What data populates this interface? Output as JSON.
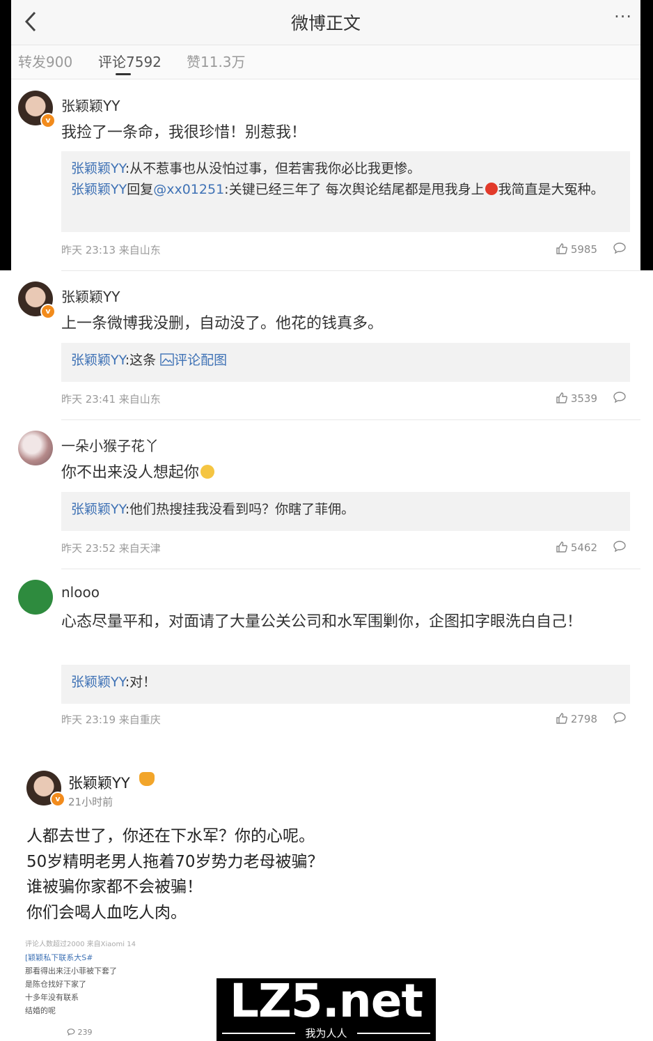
{
  "header": {
    "title": "微博正文",
    "more": "···"
  },
  "tabs": [
    {
      "label": "转发900"
    },
    {
      "label": "评论7592"
    },
    {
      "label": "赞11.3万"
    }
  ],
  "comments": [
    {
      "user": "张颖颖YY",
      "text": "我捡了一条命，我很珍惜！别惹我！",
      "replies": [
        {
          "name": "张颖颖YY",
          "body": ":从不惹事也从没怕过事，但若害我你必比我更惨。"
        },
        {
          "name": "张颖颖YY",
          "mid": "回复",
          "mention": "@xx01251",
          "body": ":关键已经三年了 每次舆论结尾都是甩我身上",
          "body2": "我简直是大冤种。"
        }
      ],
      "meta": "昨天 23:13 来自山东",
      "likes": "5985"
    },
    {
      "user": "张颖颖YY",
      "text": "上一条微博我没删，自动没了。他花的钱真多。",
      "replies": [
        {
          "name": "张颖颖YY",
          "body": ":这条 ",
          "link": "评论配图"
        }
      ],
      "meta": "昨天 23:41 来自山东",
      "likes": "3539"
    },
    {
      "user": "一朵小猴子花丫",
      "text": "你不出来没人想起你",
      "replies": [
        {
          "name": "张颖颖YY",
          "body": ":他们热搜挂我没看到吗？你瞎了菲佣。"
        }
      ],
      "meta": "昨天 23:52 来自天津",
      "likes": "5462"
    },
    {
      "user": "nlooo",
      "text": "心态尽量平和，对面请了大量公关公司和水军围剿你，企图扣字眼洗白自己！",
      "replies": [
        {
          "name": "张颖颖YY",
          "body": ":对！"
        }
      ],
      "meta": "昨天 23:19 来自重庆",
      "likes": "2798"
    }
  ],
  "post": {
    "user": "张颖颖YY",
    "time": "21小时前",
    "lines": [
      "人都去世了，你还在下水军？你的心呢。",
      "50岁精明老男人拖着70岁势力老母被骗？",
      "谁被骗你家都不会被骗！",
      "你们会喝人血吃人肉。"
    ]
  },
  "faded": {
    "meta": "评论人数超过2000  来自Xiaomi 14",
    "link": "[颖颖私下联系大S#",
    "lines": [
      "那看得出来汪小菲被下套了",
      "是陈仓找好下家了",
      "十多年没有联系",
      "结婚的呢"
    ],
    "count": "239"
  },
  "watermark": {
    "big": "LZ5.net",
    "small": "我为人人"
  },
  "colors": {
    "link": "#3f72b5",
    "badge": "#f28b1c",
    "reply_bg": "#f2f2f2"
  }
}
